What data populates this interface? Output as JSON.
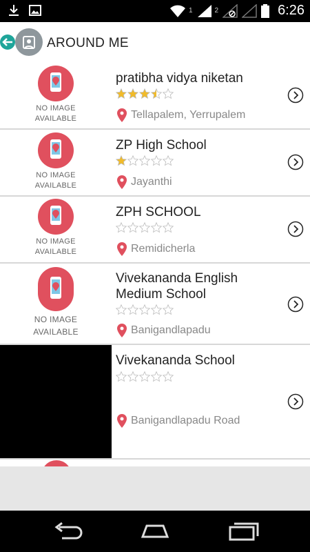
{
  "status_bar": {
    "sim_label": "1",
    "sim2_label": "2",
    "time": "6:26"
  },
  "app_bar": {
    "title": "AROUND ME"
  },
  "no_image_text": {
    "line1": "NO IMAGE",
    "line2": "AVAILABLE"
  },
  "colors": {
    "accent": "#1fa59a",
    "pin": "#e0505e",
    "star_filled": "#f1bb2a",
    "star_empty": "#ffffff"
  },
  "schools": [
    {
      "name": "pratibha vidya niketan",
      "location": "Tellapalem, Yerrupalem",
      "rating": 3.5,
      "image": "none"
    },
    {
      "name": "ZP High School",
      "location": "Jayanthi",
      "rating": 1,
      "image": "none"
    },
    {
      "name": "ZPH SCHOOL",
      "location": "Remidicherla",
      "rating": 0,
      "image": "none"
    },
    {
      "name": "Vivekananda English Medium School",
      "location": "Banigandlapadu",
      "rating": 0,
      "image": "none"
    },
    {
      "name": "Vivekananda School",
      "location": "Banigandlapadu Road",
      "rating": 0,
      "image": "black"
    }
  ],
  "nav_bar": {
    "back_icon": "back-icon",
    "home_icon": "home-icon",
    "recents_icon": "recents-icon"
  }
}
